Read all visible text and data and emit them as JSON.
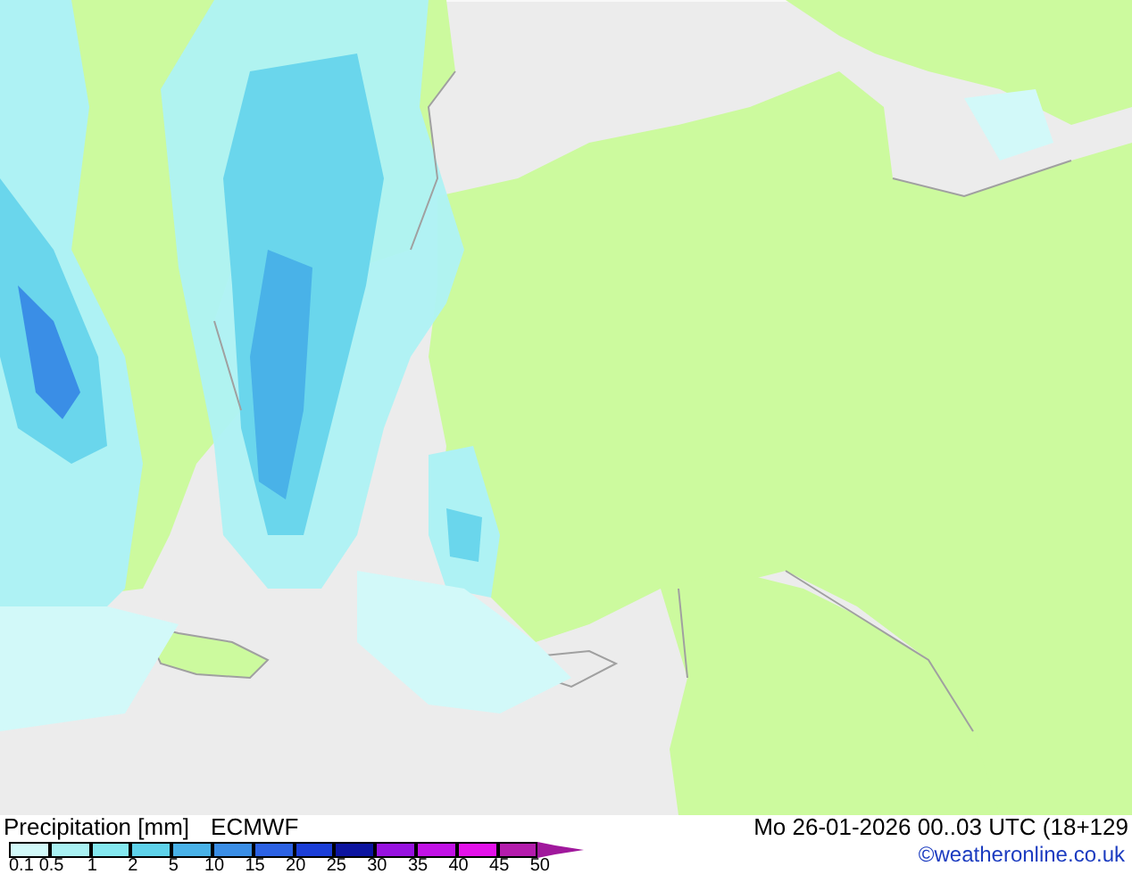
{
  "map": {
    "kind": "precipitation"
  },
  "footer": {
    "title": "Precipitation [mm]",
    "model": "ECMWF",
    "valid_time": "Mo 26-01-2026 00..03 UTC (18+129",
    "credit": "©weatheronline.co.uk"
  },
  "legend": {
    "boxes": [
      {
        "color": "#d2f9f9"
      },
      {
        "color": "#a9f1f3"
      },
      {
        "color": "#84e8f0"
      },
      {
        "color": "#5ed2ea"
      },
      {
        "color": "#49b2e8"
      },
      {
        "color": "#3a8ee6"
      },
      {
        "color": "#2c62e4"
      },
      {
        "color": "#1b3ed8"
      },
      {
        "color": "#0c14a0"
      },
      {
        "color": "#9812e0"
      },
      {
        "color": "#c212e6"
      },
      {
        "color": "#e412ea"
      },
      {
        "color": "#b41cac"
      },
      {
        "color": "#a0189c",
        "kind": "arrow"
      }
    ],
    "labels": [
      "0.1",
      "0.5",
      "1",
      "2",
      "5",
      "10",
      "15",
      "20",
      "25",
      "30",
      "35",
      "40",
      "45",
      "50"
    ]
  }
}
